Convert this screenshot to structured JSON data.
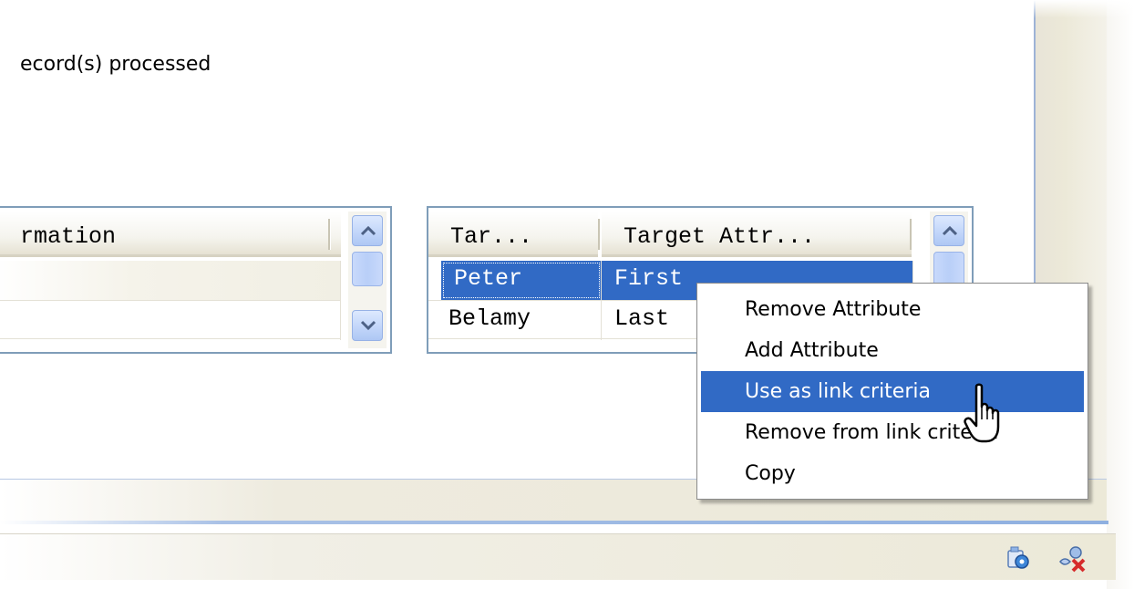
{
  "status": {
    "records_text": "ecord(s) processed"
  },
  "left_table": {
    "header": "rmation",
    "rows": [
      "",
      ""
    ]
  },
  "right_table": {
    "headers": [
      "Tar...",
      "Target Attr..."
    ],
    "rows": [
      {
        "source": "Peter",
        "target": "First",
        "selected": true
      },
      {
        "source": "Belamy",
        "target": "Last",
        "selected": false
      }
    ]
  },
  "context_menu": {
    "items": [
      {
        "label": "Remove Attribute"
      },
      {
        "label": "Add Attribute"
      },
      {
        "label": "Use as link criteria",
        "highlighted": true
      },
      {
        "label": "Remove from link criteria"
      },
      {
        "label": "Copy"
      }
    ]
  },
  "status_bar": {
    "icons": [
      "settings-icon",
      "disconnect-icon"
    ]
  },
  "colors": {
    "selection": "#316ac5",
    "frame": "#ece9d8",
    "border": "#7f9db9"
  }
}
